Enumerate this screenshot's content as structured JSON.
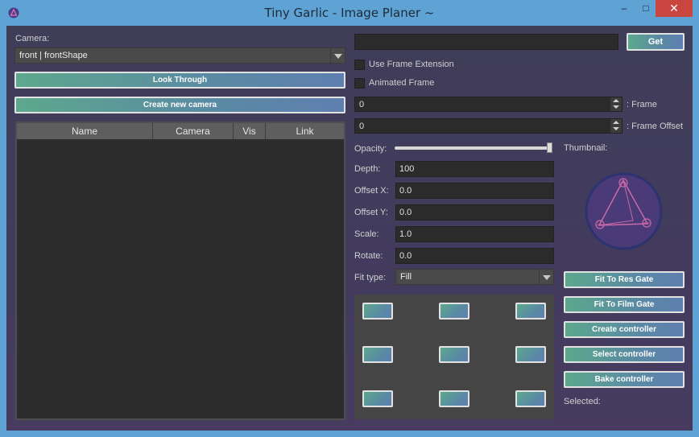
{
  "window": {
    "title": "Tiny Garlic - Image Planer ~",
    "minimize_glyph": "–",
    "maximize_glyph": "□",
    "close_glyph": "✕",
    "icon": "tiny-garlic-logo-icon"
  },
  "left": {
    "camera_label": "Camera:",
    "camera_value": "front | frontShape",
    "look_through": "Look Through",
    "create_camera": "Create new camera",
    "table_headers": [
      "Name",
      "Camera",
      "Vis",
      "Link"
    ]
  },
  "right": {
    "path_value": "",
    "get_button": "Get",
    "use_frame_extension": "Use Frame Extension",
    "animated_frame": "Animated Frame",
    "frame_value": "0",
    "frame_label": ": Frame",
    "frame_offset_value": "0",
    "frame_offset_label": ": Frame Offset",
    "opacity_label": "Opacity:",
    "opacity_value": 1.0,
    "thumbnail_label": "Thumbnail:",
    "depth_label": "Depth:",
    "depth_value": "100",
    "offset_x_label": "Offset X:",
    "offset_x_value": "0.0",
    "offset_y_label": "Offset Y:",
    "offset_y_value": "0.0",
    "scale_label": "Scale:",
    "scale_value": "1.0",
    "rotate_label": "Rotate:",
    "rotate_value": "0.0",
    "fit_type_label": "Fit type:",
    "fit_type_value": "Fill",
    "fit_res_gate": "Fit To Res Gate",
    "fit_film_gate": "Fit To Film Gate",
    "create_controller": "Create controller",
    "select_controller": "Select controller",
    "bake_controller": "Bake controller",
    "selected_label": "Selected:"
  },
  "colors": {
    "accent_gradient_start": "#5da88d",
    "accent_gradient_end": "#5f7fb0",
    "title_bar": "#5ea3d3",
    "close_button": "#c84540",
    "background": "#423b5e"
  }
}
